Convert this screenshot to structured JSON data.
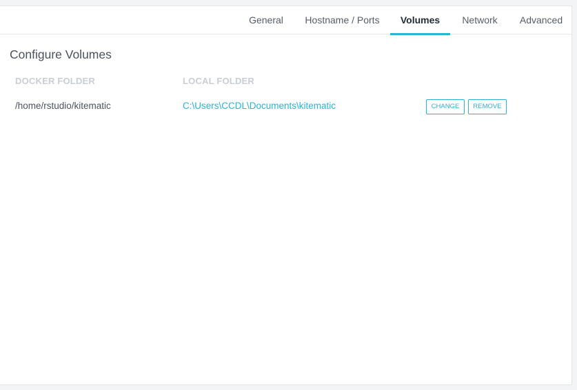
{
  "tabs": [
    "General",
    "Hostname / Ports",
    "Volumes",
    "Network",
    "Advanced"
  ],
  "active_tab": "Volumes",
  "title": "Configure Volumes",
  "columns": {
    "docker": "DOCKER FOLDER",
    "local": "LOCAL FOLDER"
  },
  "volumes": [
    {
      "docker_folder": "/home/rstudio/kitematic",
      "local_folder": "C:\\Users\\CCDL\\Documents\\kitematic",
      "change_label": "CHANGE",
      "remove_label": "REMOVE"
    }
  ],
  "colors": {
    "accent": "#2ab3d6",
    "text": "#4a525a",
    "muted_header": "#c8ced3"
  }
}
